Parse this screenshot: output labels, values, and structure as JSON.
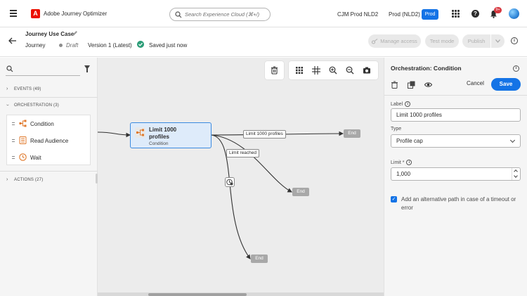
{
  "topbar": {
    "app_name": "Adobe Journey Optimizer",
    "logo_letter": "A",
    "search_placeholder": "Search Experience Cloud (⌘+/)",
    "org": "CJM Prod NLD2",
    "sandbox": "Prod (NLD2)",
    "env_badge": "Prod",
    "notif_count": "9+",
    "help_label": "?"
  },
  "journey": {
    "title": "Journey Use Case",
    "crumb": "Journey",
    "status": "Draft",
    "version": "Version 1 (Latest)",
    "save_status": "Saved just now",
    "manage_access": "Manage access",
    "test_mode": "Test mode",
    "publish": "Publish",
    "info_label": "i"
  },
  "palette": {
    "sections": [
      {
        "label": "EVENTS (49)",
        "expanded": false
      },
      {
        "label": "ORCHESTRATION (3)",
        "expanded": true
      },
      {
        "label": "ACTIONS (27)",
        "expanded": false
      }
    ],
    "orchestration_items": [
      {
        "label": "Condition",
        "icon": "condition-icon"
      },
      {
        "label": "Read Audience",
        "icon": "read-audience-icon"
      },
      {
        "label": "Wait",
        "icon": "wait-icon"
      }
    ]
  },
  "canvas": {
    "node": {
      "title": "Limit 1000 profiles",
      "subtitle": "Condition",
      "icon": "condition-icon"
    },
    "edge_labels": {
      "main": "Limit 1000 profiles",
      "limit": "Limit reached"
    },
    "end_label": "End"
  },
  "properties": {
    "title": "Orchestration: Condition",
    "cancel": "Cancel",
    "save": "Save",
    "label_field": {
      "label": "Label",
      "value": "Limit 1000 profiles"
    },
    "type_field": {
      "label": "Type",
      "value": "Profile cap"
    },
    "limit_field": {
      "label": "Limit *",
      "value": "1,000"
    },
    "timeout_checkbox": {
      "label": "Add an alternative path in case of a timeout or error",
      "checked": true
    }
  },
  "colors": {
    "accent": "#1473e6",
    "adobe_red": "#eb1000",
    "success": "#2d9d78",
    "end_node": "#a8a8a8",
    "node_bg": "#deebfa"
  }
}
